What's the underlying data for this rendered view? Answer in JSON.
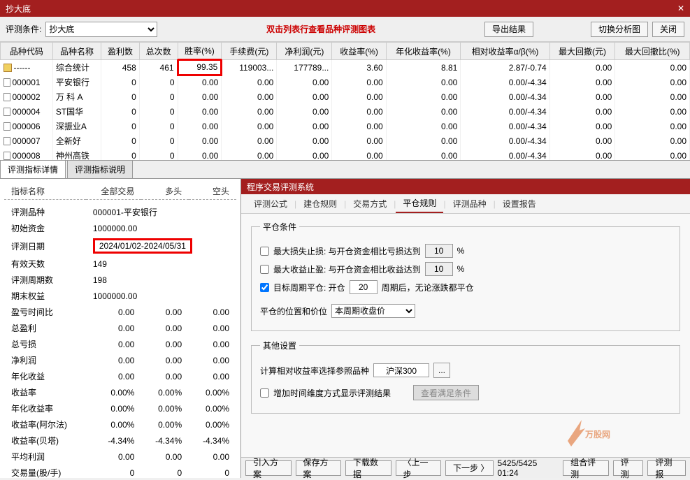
{
  "window": {
    "title": "抄大底",
    "close": "✕"
  },
  "toolbar": {
    "cond_label": "评测条件:",
    "cond_value": "抄大底",
    "hint": "双击列表行查看品种评测图表",
    "export_btn": "导出结果",
    "switch_btn": "切换分析图",
    "close_btn": "关闭"
  },
  "grid": {
    "headers": [
      "品种代码",
      "品种名称",
      "盈利数",
      "总次数",
      "胜率(%)",
      "手续费(元)",
      "净利润(元)",
      "收益率(%)",
      "年化收益率(%)",
      "相对收益率α/β(%)",
      "最大回撤(元)",
      "最大回撤比(%)"
    ],
    "rows": [
      {
        "code": "------",
        "name": "综合统计",
        "win": "458",
        "tot": "461",
        "rate": "99.35",
        "fee": "119003...",
        "net": "177789...",
        "ret": "3.60",
        "ann": "8.81",
        "rel": "2.87/-0.74",
        "dd": "0.00",
        "ddp": "0.00",
        "icon": "folder"
      },
      {
        "code": "000001",
        "name": "平安银行",
        "win": "0",
        "tot": "0",
        "rate": "0.00",
        "fee": "0.00",
        "net": "0.00",
        "ret": "0.00",
        "ann": "0.00",
        "rel": "0.00/-4.34",
        "dd": "0.00",
        "ddp": "0.00",
        "icon": "doc"
      },
      {
        "code": "000002",
        "name": "万 科 A",
        "win": "0",
        "tot": "0",
        "rate": "0.00",
        "fee": "0.00",
        "net": "0.00",
        "ret": "0.00",
        "ann": "0.00",
        "rel": "0.00/-4.34",
        "dd": "0.00",
        "ddp": "0.00",
        "icon": "doc"
      },
      {
        "code": "000004",
        "name": "ST国华",
        "win": "0",
        "tot": "0",
        "rate": "0.00",
        "fee": "0.00",
        "net": "0.00",
        "ret": "0.00",
        "ann": "0.00",
        "rel": "0.00/-4.34",
        "dd": "0.00",
        "ddp": "0.00",
        "icon": "doc"
      },
      {
        "code": "000006",
        "name": "深振业A",
        "win": "0",
        "tot": "0",
        "rate": "0.00",
        "fee": "0.00",
        "net": "0.00",
        "ret": "0.00",
        "ann": "0.00",
        "rel": "0.00/-4.34",
        "dd": "0.00",
        "ddp": "0.00",
        "icon": "doc"
      },
      {
        "code": "000007",
        "name": "全新好",
        "win": "0",
        "tot": "0",
        "rate": "0.00",
        "fee": "0.00",
        "net": "0.00",
        "ret": "0.00",
        "ann": "0.00",
        "rel": "0.00/-4.34",
        "dd": "0.00",
        "ddp": "0.00",
        "icon": "doc"
      },
      {
        "code": "000008",
        "name": "神州高铁",
        "win": "0",
        "tot": "0",
        "rate": "0.00",
        "fee": "0.00",
        "net": "0.00",
        "ret": "0.00",
        "ann": "0.00",
        "rel": "0.00/-4.34",
        "dd": "0.00",
        "ddp": "0.00",
        "icon": "doc"
      }
    ]
  },
  "tabs": {
    "t1": "评测指标详情",
    "t2": "评测指标说明"
  },
  "metrics": {
    "head": {
      "name": "指标名称",
      "all": "全部交易",
      "long": "多头",
      "short": "空头"
    },
    "product_lbl": "评测品种",
    "product_val": "000001-平安银行",
    "initfund_lbl": "初始资金",
    "initfund_val": "1000000.00",
    "date_lbl": "评测日期",
    "date_val": "2024/01/02-2024/05/31",
    "days_lbl": "有效天数",
    "days_val": "149",
    "cycles_lbl": "评测周期数",
    "cycles_val": "198",
    "endeq_lbl": "期末权益",
    "endeq_val": "1000000.00",
    "plratio_lbl": "盈亏时间比",
    "plratio_all": "0.00",
    "plratio_long": "0.00",
    "plratio_short": "0.00",
    "tprofit_lbl": "总盈利",
    "tprofit_all": "0.00",
    "tprofit_long": "0.00",
    "tprofit_short": "0.00",
    "tloss_lbl": "总亏损",
    "tloss_all": "0.00",
    "tloss_long": "0.00",
    "tloss_short": "0.00",
    "netp_lbl": "净利润",
    "netp_all": "0.00",
    "netp_long": "0.00",
    "netp_short": "0.00",
    "annp_lbl": "年化收益",
    "annp_all": "0.00",
    "annp_long": "0.00",
    "annp_short": "0.00",
    "retr_lbl": "收益率",
    "retr_all": "0.00%",
    "retr_long": "0.00%",
    "retr_short": "0.00%",
    "annr_lbl": "年化收益率",
    "annr_all": "0.00%",
    "annr_long": "0.00%",
    "annr_short": "0.00%",
    "alpha_lbl": "收益率(阿尔法)",
    "alpha_all": "0.00%",
    "alpha_long": "0.00%",
    "alpha_short": "0.00%",
    "beta_lbl": "收益率(贝塔)",
    "beta_all": "-4.34%",
    "beta_long": "-4.34%",
    "beta_short": "-4.34%",
    "avgp_lbl": "平均利润",
    "avgp_all": "0.00",
    "avgp_long": "0.00",
    "avgp_short": "0.00",
    "vol_lbl": "交易量(股/手)",
    "vol_all": "0",
    "vol_long": "0",
    "vol_short": "0"
  },
  "sub": {
    "title": "程序交易评测系统",
    "tabs": [
      "评测公式",
      "建仓规则",
      "交易方式",
      "平仓规则",
      "评测品种",
      "设置报告"
    ],
    "active_idx": 3,
    "fs1_legend": "平仓条件",
    "cb1": "最大损失止损: 与开仓资金相比亏损达到",
    "cb1_val": "10",
    "pct": "%",
    "cb2": "最大收益止盈: 与开仓资金相比收益达到",
    "cb2_val": "10",
    "cb3": "目标周期平仓: 开仓",
    "cb3_val": "20",
    "cb3_suffix": "周期后，无论涨跌都平仓",
    "pos_lbl": "平仓的位置和价位",
    "pos_val": "本周期收盘价",
    "fs2_legend": "其他设置",
    "ref_lbl": "计算相对收益率选择参照品种",
    "ref_val": "沪深300",
    "ref_btn": "...",
    "cb4": "增加时间维度方式显示评测结果",
    "view_btn": "查看满足条件",
    "bottom": {
      "import": "引入方案",
      "save": "保存方案",
      "download": "下载数据",
      "prev": "〈上一步",
      "next": "下一步 〉",
      "status": "5425/5425 01:24",
      "combo": "组合评测",
      "single": "评测",
      "report": "评测报"
    }
  }
}
